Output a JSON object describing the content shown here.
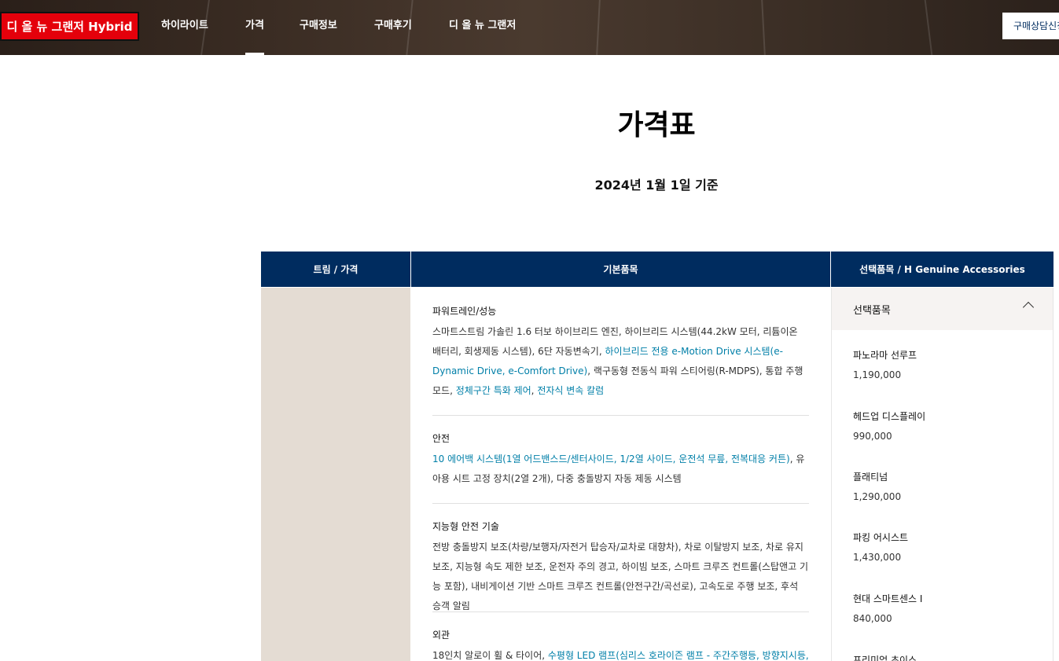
{
  "header": {
    "brand": "디 올 뉴 그랜저 Hybrid",
    "nav": [
      {
        "label": "하이라이트",
        "active": false
      },
      {
        "label": "가격",
        "active": true
      },
      {
        "label": "구매정보",
        "active": false
      },
      {
        "label": "구매후기",
        "active": false
      },
      {
        "label": "디 올 뉴 그랜저",
        "active": false
      }
    ],
    "consult_button": "구매상담신청"
  },
  "page": {
    "title": "가격표",
    "date": "2024년 1월 1일 기준"
  },
  "table": {
    "headers": {
      "trim": "트림 / 가격",
      "basic": "기본품목",
      "option": "선택품목 / H Genuine Accessories"
    },
    "basic_features": [
      {
        "title": "파워트레인/성능",
        "segments": [
          {
            "text": "스마트스트림 가솔린 1.6 터보 하이브리드 엔진, 하이브리드 시스템(44.2kW 모터, 리튬이온 배터리, 회생제동 시스템), 6단 자동변속기, ",
            "highlight": false
          },
          {
            "text": "하이브리드 전용 e-Motion Drive 시스템(e-Dynamic Drive, e-Comfort Drive)",
            "highlight": true
          },
          {
            "text": ", 랙구동형 전동식 파워 스티어링(R-MDPS), 통합 주행 모드, ",
            "highlight": false
          },
          {
            "text": "정체구간 특화 제어",
            "highlight": true
          },
          {
            "text": ", ",
            "highlight": false
          },
          {
            "text": "전자식 변속 칼럼",
            "highlight": true
          }
        ]
      },
      {
        "title": "안전",
        "segments": [
          {
            "text": "10 에어백 시스템(1열 어드밴스드/센터사이드, 1/2열 사이드, 운전석 무릎, 전복대응 커튼)",
            "highlight": true
          },
          {
            "text": ", 유아용 시트 고정 장치(2열 2개), 다중 충돌방지 자동 제동 시스템",
            "highlight": false
          }
        ]
      },
      {
        "title": "지능형 안전 기술",
        "segments": [
          {
            "text": "전방 충돌방지 보조(차량/보행자/자전거 탑승자/교차로 대향차), 차로 이탈방지 보조, 차로 유지 보조, 지능형 속도 제한 보조, 운전자 주의 경고, 하이빔 보조, 스마트 크루즈 컨트롤(스탑앤고 기능 포함), 내비게이션 기반 스마트 크루즈 컨트롤(안전구간/곡선로), 고속도로 주행 보조, 후석 승객 알림",
            "highlight": false
          }
        ]
      },
      {
        "title": "외관",
        "segments": [
          {
            "text": "18인치 알로이 휠 & 타이어, ",
            "highlight": false
          },
          {
            "text": "수평형 LED 램프(심리스 호라이즌 램프 - 주간주행등, 방향지시등,",
            "highlight": true
          }
        ]
      }
    ],
    "options": {
      "section_label": "선택품목",
      "items": [
        {
          "name": "파노라마 선루프",
          "price": "1,190,000"
        },
        {
          "name": "헤드업 디스플레이",
          "price": "990,000"
        },
        {
          "name": "플래티넘",
          "price": "1,290,000"
        },
        {
          "name": "파킹 어시스트",
          "price": "1,430,000"
        },
        {
          "name": "현대 스마트센스 I",
          "price": "840,000"
        },
        {
          "name": "프리미엄 초이스",
          "price": ""
        }
      ]
    }
  }
}
